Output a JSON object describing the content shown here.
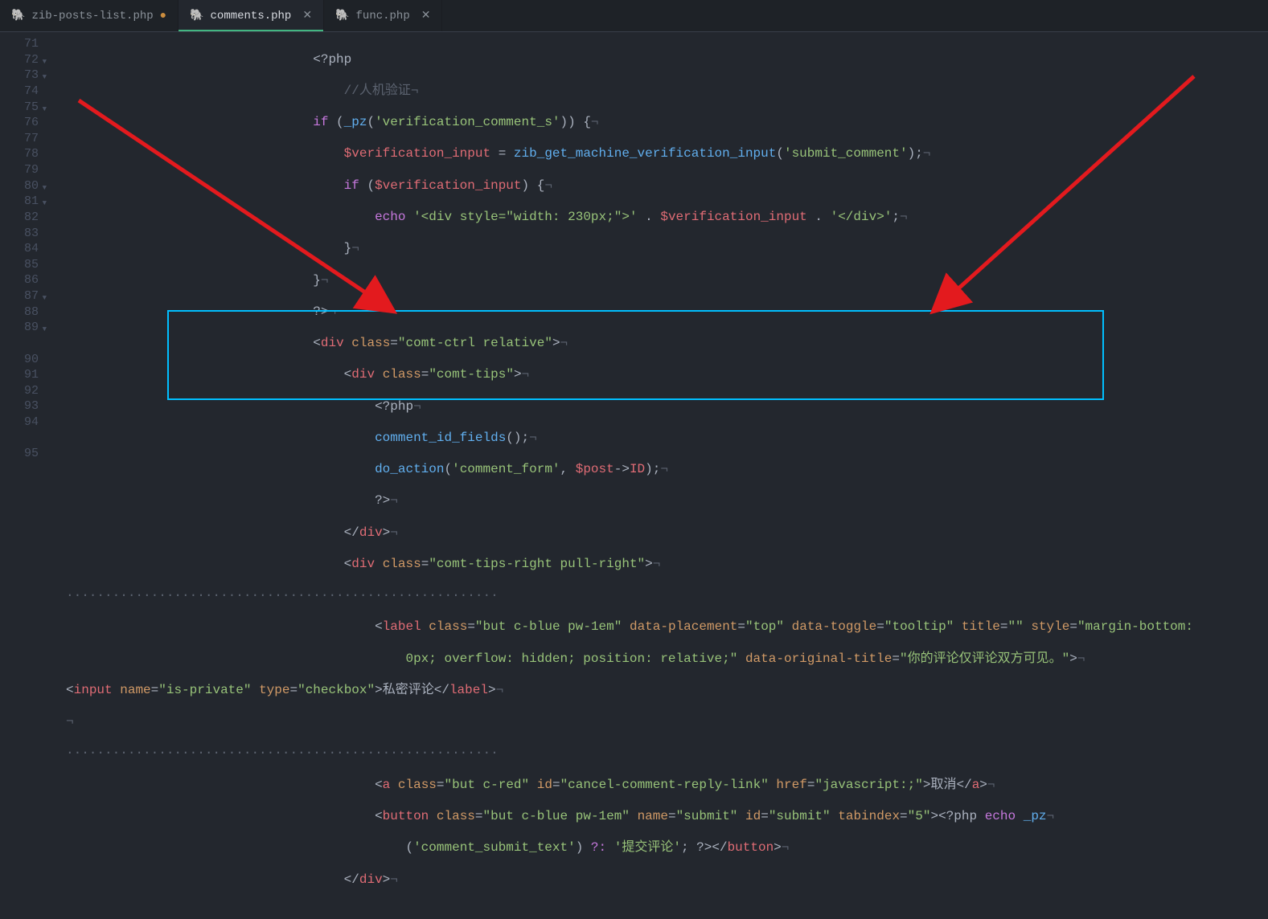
{
  "tabs": [
    {
      "icon": "🐘",
      "name": "zib-posts-list.php",
      "modified": true,
      "closable": false,
      "active": false
    },
    {
      "icon": "🐘",
      "name": "comments.php",
      "modified": false,
      "closable": true,
      "active": true
    },
    {
      "icon": "🐘",
      "name": "func.php",
      "modified": false,
      "closable": true,
      "active": false
    }
  ],
  "gutter": {
    "start": 71,
    "end": 95,
    "folds": [
      72,
      73,
      75,
      80,
      81,
      87,
      89
    ]
  },
  "code": {
    "l71": {
      "i": "                                ",
      "a": "<?php"
    },
    "l72": {
      "i": "                                    ",
      "a": "//人机验证",
      "inv": "¬"
    },
    "l73": {
      "i": "                                ",
      "kw": "if",
      "p1": " (",
      "fn": "_pz",
      "p2": "(",
      "s": "'verification_comment_s'",
      "p3": ")) {",
      "inv": "¬"
    },
    "l74": {
      "i": "                                    ",
      "v": "$verification_input",
      "op": " = ",
      "fn": "zib_get_machine_verification_input",
      "p1": "(",
      "s": "'submit_comment'",
      "p2": ");",
      "inv": "¬"
    },
    "l75": {
      "i": "                                    ",
      "kw": "if",
      "p1": " (",
      "v": "$verification_input",
      "p2": ") {",
      "inv": "¬"
    },
    "l76": {
      "i": "                                        ",
      "kw": "echo",
      "sp": " ",
      "s1": "'<div style=\"width: 230px;\">'",
      "op1": " . ",
      "v": "$verification_input",
      "op2": " . ",
      "s2": "'</div>'",
      "p": ";",
      "inv": "¬"
    },
    "l77": {
      "i": "                                    ",
      "p": "}",
      "inv": "¬"
    },
    "l78": {
      "i": "                                ",
      "p": "}",
      "inv": "¬"
    },
    "l79": {
      "i": "                                ",
      "p": "?>",
      "inv": "¬"
    },
    "l80": {
      "i": "                                ",
      "o": "<",
      "t": "div",
      "sp": " ",
      "a": "class",
      "eq": "=",
      "s": "\"comt-ctrl relative\"",
      "c": ">",
      "inv": "¬"
    },
    "l81": {
      "i": "                                    ",
      "o": "<",
      "t": "div",
      "sp": " ",
      "a": "class",
      "eq": "=",
      "s": "\"comt-tips\"",
      "c": ">",
      "inv": "¬"
    },
    "l82": {
      "i": "                                        ",
      "a": "<?php",
      "inv": "¬"
    },
    "l83": {
      "i": "                                        ",
      "fn": "comment_id_fields",
      "p": "();",
      "inv": "¬"
    },
    "l84": {
      "i": "                                        ",
      "fn": "do_action",
      "p1": "(",
      "s": "'comment_form'",
      "p2": ", ",
      "v": "$post",
      "op": "->",
      "prop": "ID",
      "p3": ");",
      "inv": "¬"
    },
    "l85": {
      "i": "                                        ",
      "p": "?>",
      "inv": "¬"
    },
    "l86": {
      "i": "                                    ",
      "o": "</",
      "t": "div",
      "c": ">",
      "inv": "¬"
    },
    "l87": {
      "i": "                                    ",
      "o": "<",
      "t": "div",
      "sp": " ",
      "a": "class",
      "eq": "=",
      "s": "\"comt-tips-right pull-right\"",
      "c": ">",
      "inv": "¬"
    },
    "l88": {
      "dots": "························································"
    },
    "l89a": {
      "i": "                                        ",
      "o": "<",
      "t": "label",
      "sp": " ",
      "a1": "class",
      "s1": "\"but c-blue pw-1em\"",
      "a2": "data-placement",
      "s2": "\"top\"",
      "a3": "data-toggle",
      "s3": "\"tooltip\"",
      "a4": "title",
      "s4": "\"\"",
      "a5": "style",
      "s5a": "\"margin-bottom:"
    },
    "l89b": {
      "i": "                                            ",
      "s5b": "0px; overflow: hidden; position: relative;\"",
      "a6": "data-original-title",
      "s6": "\"你的评论仅评论双方可见。\"",
      "c": ">",
      "inv": "¬"
    },
    "l90": {
      "i": "",
      "o": "<",
      "t": "input",
      "sp": " ",
      "a1": "name",
      "s1": "\"is-private\"",
      "a2": "type",
      "s2": "\"checkbox\"",
      "c": ">",
      "txt": "私密评论",
      "o2": "</",
      "t2": "label",
      "c2": ">",
      "inv": "¬"
    },
    "l91": {
      "inv": "¬"
    },
    "l92": {
      "dots": "························································"
    },
    "l93": {
      "i": "                                        ",
      "o": "<",
      "t": "a",
      "sp": " ",
      "a1": "class",
      "s1": "\"but c-red\"",
      "a2": "id",
      "s2": "\"cancel-comment-reply-link\"",
      "a3": "href",
      "s3": "\"javascript:;\"",
      "c": ">",
      "txt": "取消",
      "o2": "</",
      "t2": "a",
      "c2": ">",
      "inv": "¬"
    },
    "l94a": {
      "i": "                                        ",
      "o": "<",
      "t": "button",
      "sp": " ",
      "a1": "class",
      "s1": "\"but c-blue pw-1em\"",
      "a2": "name",
      "s2": "\"submit\"",
      "a3": "id",
      "s3": "\"submit\"",
      "a4": "tabindex",
      "s4": "\"5\"",
      "c": ">",
      "php": "<?php",
      "sp2": " ",
      "kw": "echo",
      "sp3": " ",
      "fn": "_pz",
      "inv": "¬"
    },
    "l94b": {
      "i": "                                            ",
      "p1": "(",
      "s": "'comment_submit_text'",
      "p2": ") ",
      "op": "?:",
      "sp": " ",
      "s2": "'提交评论'",
      "p3": "; ",
      "php": "?>",
      "o2": "</",
      "t2": "button",
      "c2": ">",
      "inv": "¬"
    },
    "l95": {
      "i": "                                    ",
      "o": "</",
      "t": "div",
      "c": ">",
      "inv": "¬"
    }
  }
}
